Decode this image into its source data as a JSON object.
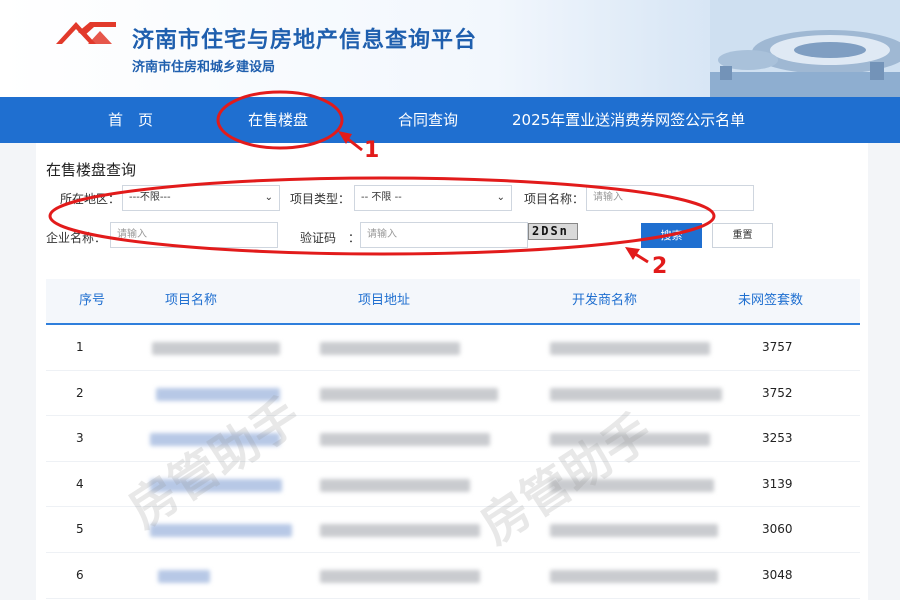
{
  "header": {
    "title": "济南市住宅与房地产信息查询平台",
    "subtitle": "济南市住房和城乡建设局"
  },
  "nav": {
    "items": [
      {
        "label": "首　页"
      },
      {
        "label": "在售楼盘"
      },
      {
        "label": "合同查询"
      },
      {
        "label": "2025年置业送消费券网签公示名单"
      }
    ]
  },
  "search": {
    "section_title": "在售楼盘查询",
    "region_label": "所在地区：",
    "region_value": "---不限---",
    "type_label": "项目类型：",
    "type_value": "-- 不限 --",
    "project_name_label": "项目名称：",
    "project_name_placeholder": "请输入",
    "company_label": "企业名称：",
    "company_placeholder": "请输入",
    "captcha_label": "验证码　：",
    "captcha_placeholder": "请输入",
    "captcha_text": "2DSn",
    "search_button": "搜索",
    "reset_button": "重置"
  },
  "table": {
    "headers": [
      "序号",
      "项目名称",
      "项目地址",
      "开发商名称",
      "未网签套数"
    ],
    "rows": [
      {
        "index": "1",
        "count": "3757"
      },
      {
        "index": "2",
        "count": "3752"
      },
      {
        "index": "3",
        "count": "3253"
      },
      {
        "index": "4",
        "count": "3139"
      },
      {
        "index": "5",
        "count": "3060"
      },
      {
        "index": "6",
        "count": "3048"
      }
    ]
  },
  "watermark": {
    "text": "房管助手"
  },
  "annotations": {
    "label_1": "1",
    "label_2": "2"
  },
  "colors": {
    "brand_blue": "#1f6fd0",
    "annotation_red": "#e21b1b",
    "logo_red": "#e23a2b"
  }
}
